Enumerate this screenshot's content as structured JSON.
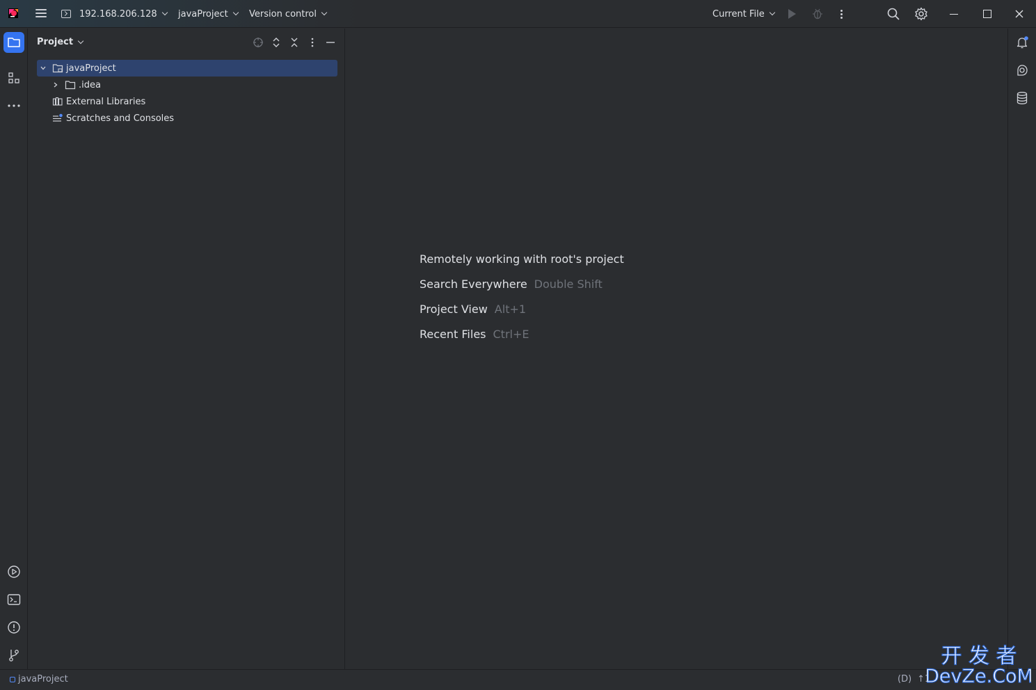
{
  "titlebar": {
    "remote_host": "192.168.206.128",
    "project_name": "javaProject",
    "vcs_label": "Version control",
    "run_config": "Current File"
  },
  "project_panel": {
    "title": "Project",
    "tree": [
      {
        "label": "javaProject",
        "icon": "folder-icon",
        "expanded": true,
        "selected": true
      },
      {
        "label": ".idea",
        "icon": "folder-icon",
        "expanded": false
      },
      {
        "label": "External Libraries",
        "icon": "library-icon"
      },
      {
        "label": "Scratches and Consoles",
        "icon": "scratches-icon"
      }
    ]
  },
  "editor": {
    "hints": [
      {
        "label": "Remotely working with root's project",
        "key": ""
      },
      {
        "label": "Search Everywhere",
        "key": "Double Shift"
      },
      {
        "label": "Project View",
        "key": "Alt+1"
      },
      {
        "label": "Recent Files",
        "key": "Ctrl+E"
      }
    ]
  },
  "statusbar": {
    "project": "javaProject",
    "right_a": "(D)",
    "right_b": "↑1"
  },
  "watermark": {
    "top_text": "开 发 者",
    "bottom_text": "DevZe.CoM"
  },
  "colors": {
    "accent": "#3574f0",
    "selection": "#2e436e",
    "background": "#2b2d30",
    "hint_key": "#6f737a"
  }
}
